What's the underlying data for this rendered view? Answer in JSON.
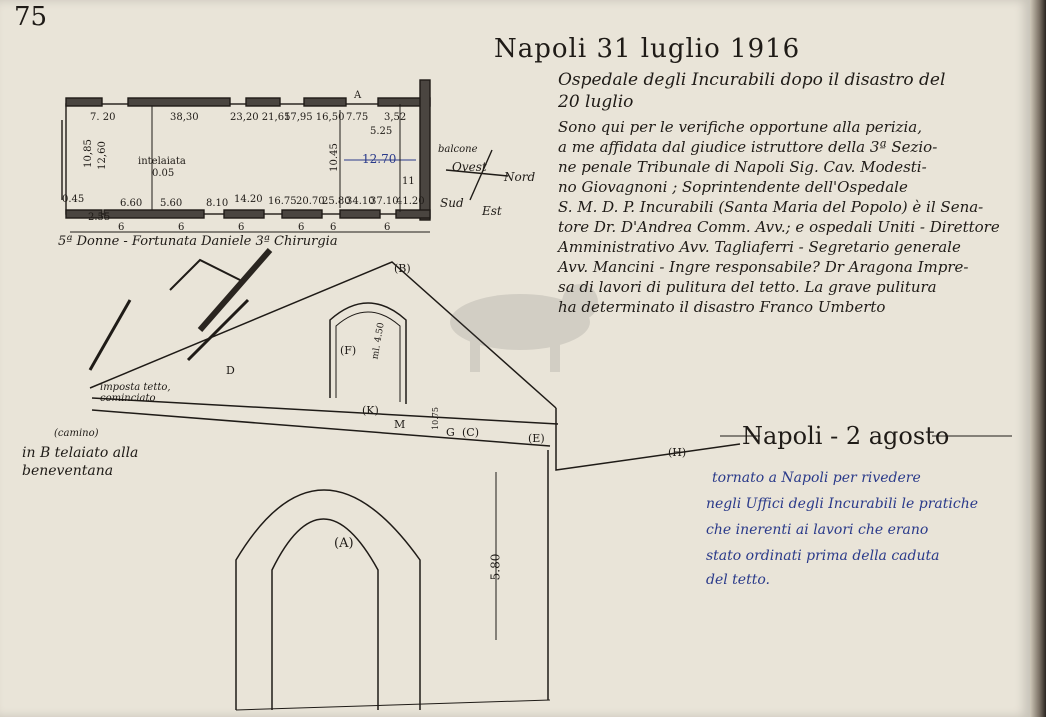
{
  "page_number": "75",
  "heading": {
    "title": "Napoli 31 luglio 1916",
    "subtitle_1": "Ospedale degli Incurabili dopo il disastro del",
    "subtitle_2": "20 luglio"
  },
  "letter_lines": [
    "Sono qui per le verifiche opportune alla perizia,",
    "a me affidata dal giudice istruttore della 3ª Sezio-",
    "ne penale Tribunale di Napoli Sig. Cav. Modesti-",
    "no Giovagnoni ; Soprintendente dell'Ospedale",
    "S. M. D. P. Incurabili (Santa Maria del Popolo) è il Sena-",
    "tore Dr. D'Andrea Comm. Avv.; e ospedali Uniti - Direttore",
    "Amministrativo Avv. Tagliaferri - Segretario generale",
    "Avv. Mancini - Ingre responsabile? Dr Aragona Impre-",
    "sa di lavori di pulitura del tetto. La grave pulitura",
    "ha determinato il disastro Franco Umberto"
  ],
  "plan": {
    "caption": "5ª Donne - Fortunata Daniele 3ª Chirurgia",
    "labels_top": [
      "7. 20",
      "38,30",
      "23,20 21,65",
      "17,95 16,50",
      "7.75",
      "3,52",
      "5.25"
    ],
    "labels_bottom": [
      "0.45",
      "2.55",
      "6.60",
      "5.60",
      "8.10",
      "14.20",
      "16.75",
      "20.70",
      "25.80",
      "34.10",
      "37.10",
      "41.20"
    ],
    "labels_spans": [
      "6",
      "6",
      "6",
      "6",
      "6",
      "6"
    ],
    "label_center": "intelaiata",
    "label_center_sub": "0.05",
    "label_left": "10,85",
    "label_left_sub": "12,60",
    "label_right": "12.70",
    "label_right_v": "10.45",
    "label_side": "11",
    "label_a": "A",
    "compass": {
      "balcony": "balcone",
      "west": "Ovest",
      "north": "Nord",
      "south": "Sud",
      "east": "Est"
    }
  },
  "sketch": {
    "label_a": "(A)",
    "label_b": "(B)",
    "label_f": "(F)",
    "label_d": "D",
    "label_k": "(K)",
    "label_m": "M",
    "label_c": "(C)",
    "label_e": "(E)",
    "label_h": "(H)",
    "label_g": "G",
    "label_height": "5.80",
    "label_arch_v": "ml. 4.50",
    "label_small": "10.75"
  },
  "notes": {
    "impost": "imposta tetto, cominciato",
    "b_note_sup": "(camino)",
    "b_note": "in B telaiato alla beneventana"
  },
  "second_entry": {
    "title": "Napoli - 2 agosto",
    "lines": [
      "tornato a Napoli per rivedere",
      "negli Uffici degli Incurabili le pratiche",
      "che inerenti ai lavori che erano",
      "stato ordinati prima della caduta",
      "del tetto."
    ]
  },
  "colors": {
    "paper": "#e9e4d8",
    "ink": "#1f1b17",
    "blue_ink": "#2a3a8a"
  }
}
